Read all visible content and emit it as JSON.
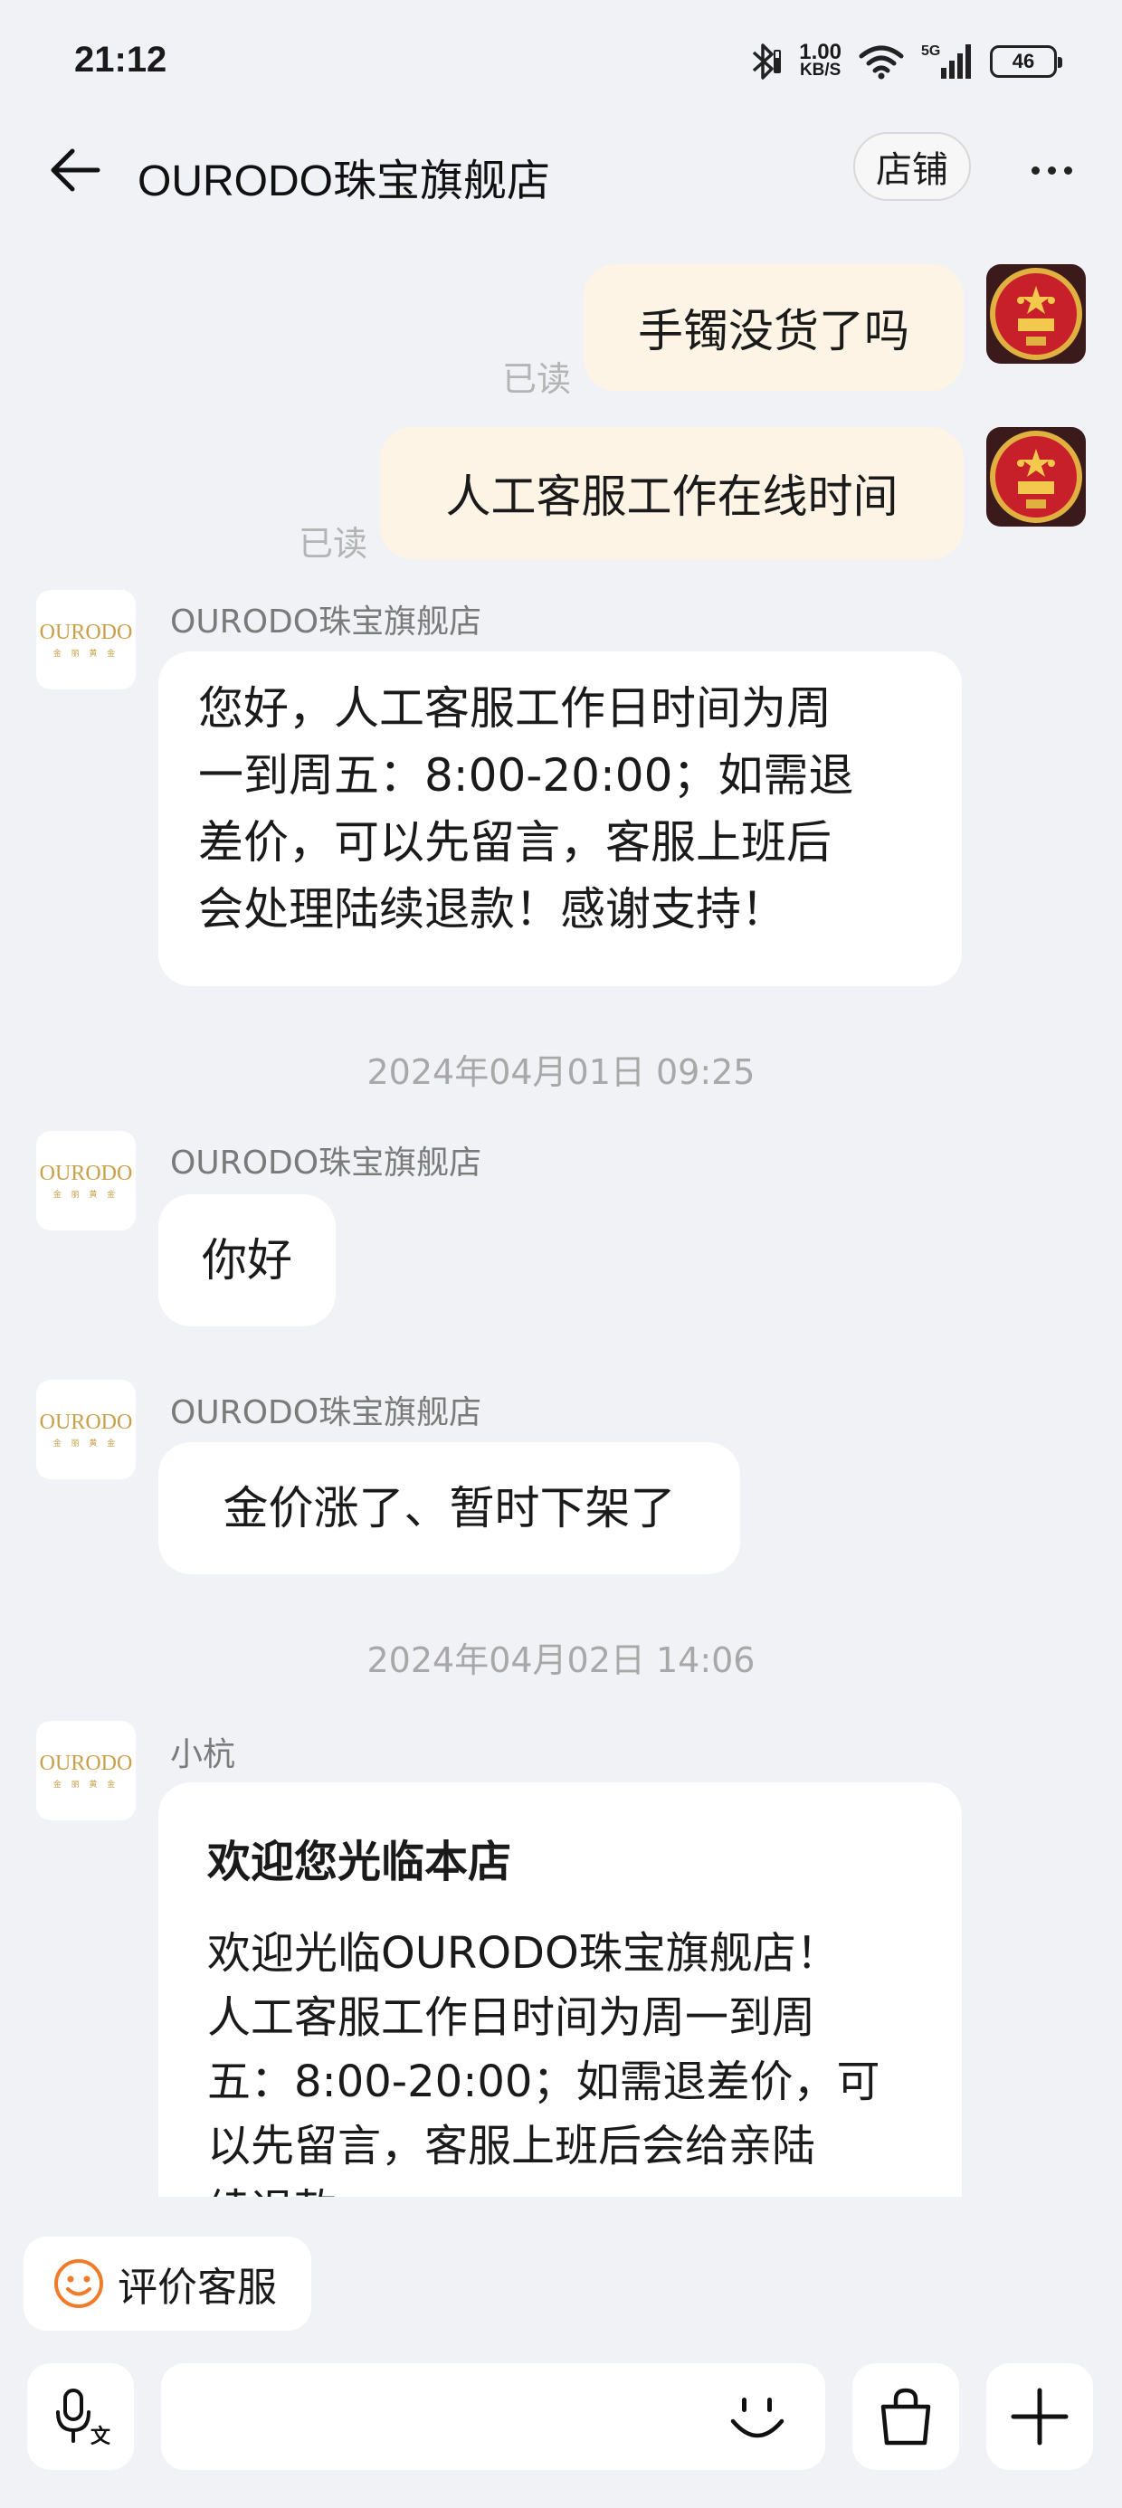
{
  "status_bar": {
    "time": "21:12",
    "net_speed_value": "1.00",
    "net_speed_unit": "KB/S",
    "network": "5G",
    "battery": "46"
  },
  "header": {
    "title": "OURODO珠宝旗舰店",
    "store_button": "店铺"
  },
  "shop_logo": {
    "text": "OURODO",
    "sub": "金 丽 黄 金"
  },
  "messages": {
    "m1": {
      "text": "手镯没货了吗",
      "read": "已读"
    },
    "m2": {
      "text": "人工客服工作在线时间",
      "read": "已读"
    },
    "m3": {
      "sender": "OURODO珠宝旗舰店",
      "lines": [
        "您好，人工客服工作日时间为周",
        "一到周五：8:00-20:00；如需退",
        "差价，可以先留言，客服上班后",
        "会处理陆续退款！感谢支持！"
      ]
    },
    "sep1": "2024年04月01日 09:25",
    "m4": {
      "sender": "OURODO珠宝旗舰店",
      "text": "你好"
    },
    "m5": {
      "sender": "OURODO珠宝旗舰店",
      "text": "金价涨了、暂时下架了"
    },
    "sep2": "2024年04月02日 14:06",
    "m6": {
      "sender": "小杭",
      "title": "欢迎您光临本店",
      "lines": [
        "欢迎光临OURODO珠宝旗舰店！",
        "人工客服工作日时间为周一到周",
        "五：8:00-20:00；如需退差价，可",
        "以先留言，客服上班后会给亲陆",
        "续退款"
      ]
    }
  },
  "bottom": {
    "rate_button": "评价客服",
    "voice_sub": "文"
  },
  "colors": {
    "background": "#f1f2f6",
    "my_bubble": "#fdf4e5",
    "shop_bubble": "#ffffff",
    "logo_gold": "#c8a04a",
    "rate_icon": "#f07b2a"
  }
}
